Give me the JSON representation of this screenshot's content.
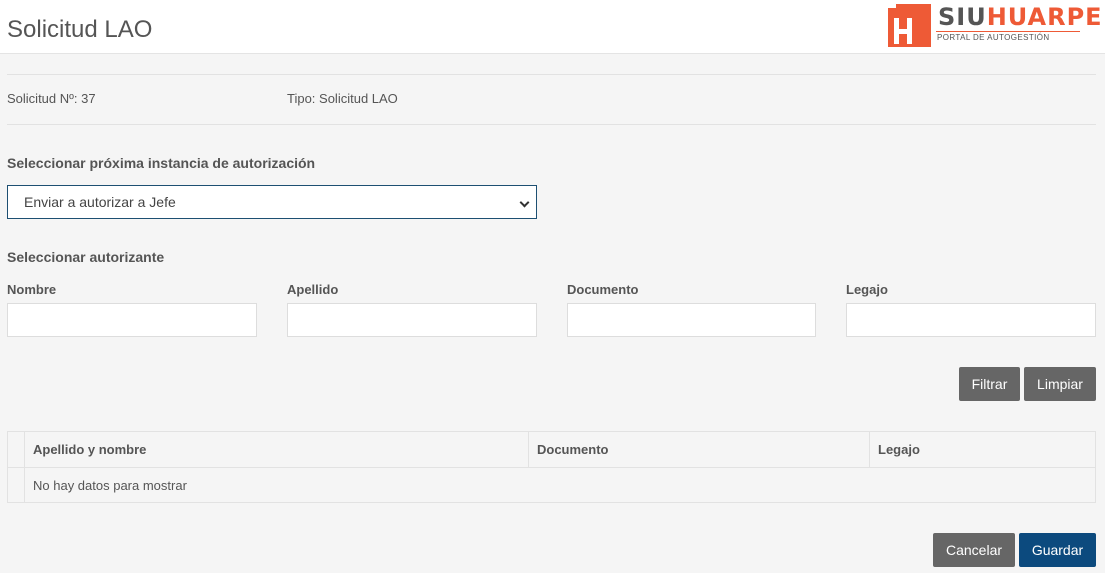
{
  "header": {
    "title": "Solicitud LAO",
    "logo": {
      "brand_siu": "SIU",
      "brand_huarpe": "HUARPE",
      "subtitle": "PORTAL DE AUTOGESTIÓN",
      "accent_color": "#ee5a36"
    }
  },
  "info": {
    "solicitud": "Solicitud Nº: 37",
    "tipo": "Tipo: Solicitud LAO"
  },
  "instancia": {
    "label": "Seleccionar próxima instancia de autorización",
    "selected": "Enviar a autorizar a Jefe"
  },
  "autorizante": {
    "label": "Seleccionar autorizante",
    "fields": [
      {
        "label": "Nombre",
        "value": "",
        "placeholder": ""
      },
      {
        "label": "Apellido",
        "value": "",
        "placeholder": ""
      },
      {
        "label": "Documento",
        "value": "",
        "placeholder": ""
      },
      {
        "label": "Legajo",
        "value": "",
        "placeholder": ""
      }
    ],
    "filter_button": "Filtrar",
    "clear_button": "Limpiar"
  },
  "table": {
    "columns": [
      "Apellido y nombre",
      "Documento",
      "Legajo"
    ],
    "empty_message": "No hay datos para mostrar"
  },
  "actions": {
    "cancel": "Cancelar",
    "save": "Guardar"
  },
  "colors": {
    "primary": "#0c4a7e",
    "secondary": "#666666",
    "select_border": "#1d4f72"
  }
}
